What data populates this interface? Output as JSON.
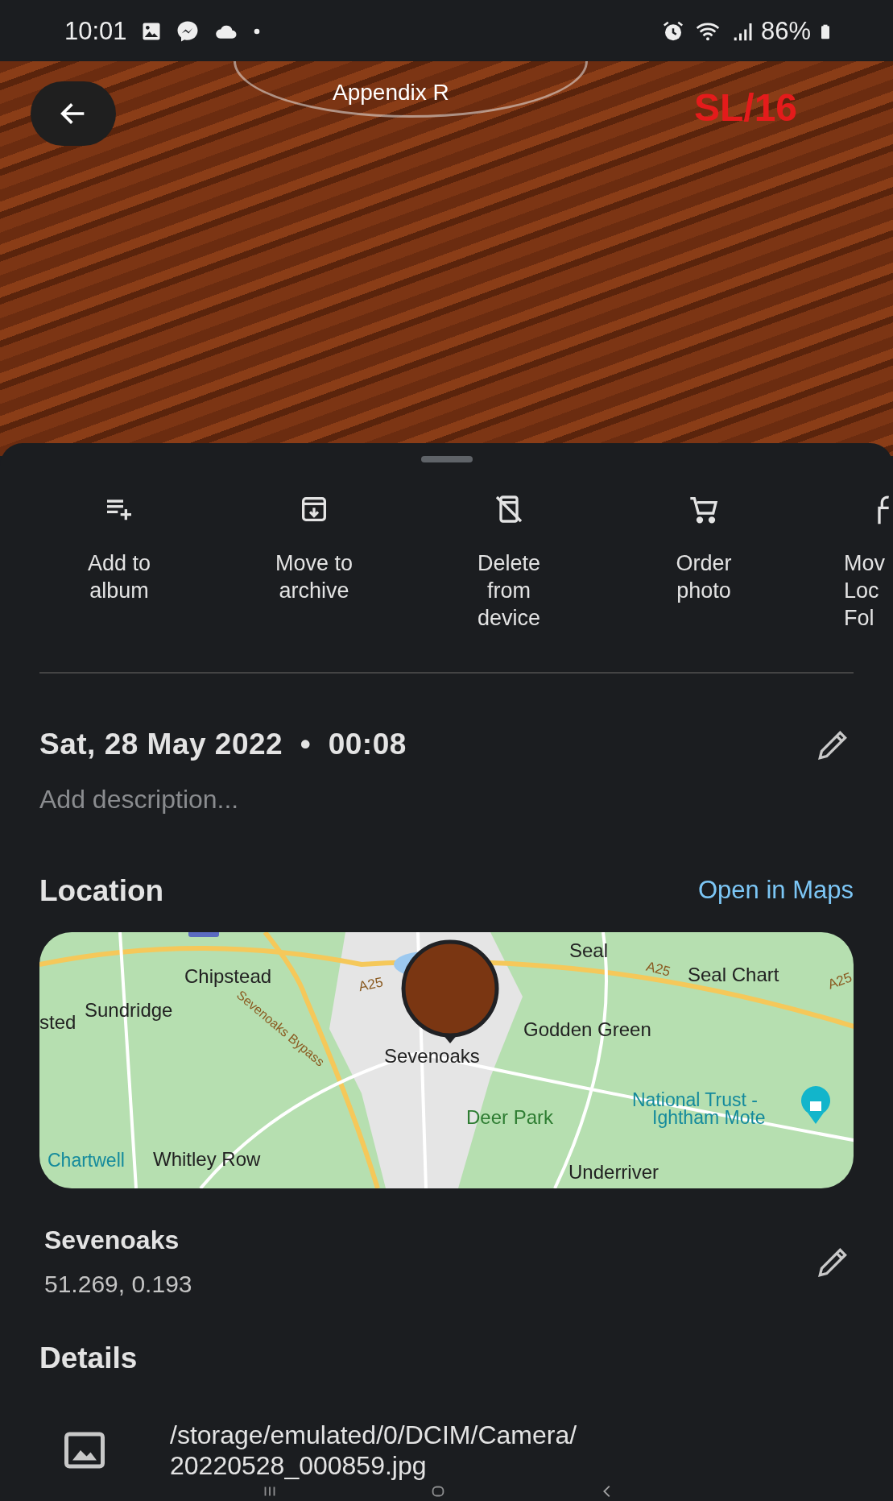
{
  "status_bar": {
    "time": "10:01",
    "battery": "86%"
  },
  "photo": {
    "caption": "Appendix R",
    "reference": "SL/16"
  },
  "actions": [
    {
      "lines": [
        "Add to",
        "album"
      ]
    },
    {
      "lines": [
        "Move to",
        "archive"
      ]
    },
    {
      "lines": [
        "Delete",
        "from",
        "device"
      ]
    },
    {
      "lines": [
        "Order",
        "photo"
      ]
    },
    {
      "lines": [
        "Mov",
        "Loc",
        "Fol"
      ]
    }
  ],
  "info": {
    "date": "Sat, 28 May 2022",
    "separator": "•",
    "time": "00:08",
    "description": {
      "placeholder": "Add description..."
    }
  },
  "location": {
    "heading": "Location",
    "link": "Open in Maps",
    "map_labels": [
      "Chipstead",
      "Sundridge",
      "sted",
      "Sevenoaks Bypass",
      "A25",
      "Seal",
      "A25",
      "Seal Chart",
      "A25",
      "Sevenoaks",
      "Godden Green",
      "Deer Park",
      "National Trust -",
      "Ightham Mote",
      "Chartwell",
      "Whitley Row",
      "Underriver"
    ],
    "place": "Sevenoaks",
    "coordinates": "51.269, 0.193"
  },
  "details": {
    "heading": "Details",
    "path": "/storage/emulated/0/DCIM/Camera/",
    "file": "20220528_000859.jpg"
  }
}
